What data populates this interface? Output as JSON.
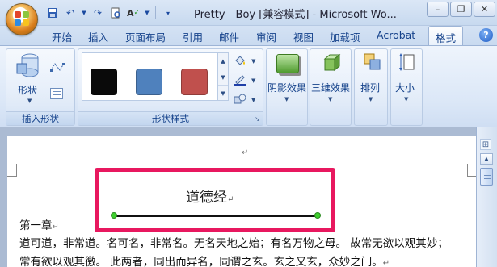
{
  "titlebar": {
    "title": "Pretty—Boy [兼容模式] - Microsoft Wo...",
    "qat_icons": [
      "save-icon",
      "undo-icon",
      "redo-icon",
      "print-preview-icon",
      "spelling-icon",
      "customize-icon"
    ]
  },
  "window_controls": {
    "minimize": "–",
    "restore": "❐",
    "close": "✕"
  },
  "tabs": [
    {
      "label": "开始"
    },
    {
      "label": "插入"
    },
    {
      "label": "页面布局"
    },
    {
      "label": "引用"
    },
    {
      "label": "邮件"
    },
    {
      "label": "审阅"
    },
    {
      "label": "视图"
    },
    {
      "label": "加载项"
    },
    {
      "label": "Acrobat"
    },
    {
      "label": "格式"
    }
  ],
  "ribbon": {
    "insert_shape": {
      "shape_btn": "形状",
      "group_label": "插入形状"
    },
    "shape_styles": {
      "group_label": "形状样式",
      "swatches": [
        "#0a0a0a",
        "#4f81bd",
        "#c0504d"
      ]
    },
    "buttons": {
      "shadow": "阴影效果",
      "threed": "三维效果",
      "arrange": "排列",
      "size": "大小"
    }
  },
  "document": {
    "heading": "道德经",
    "chapter": "第一章",
    "line1": "道可道，非常道。名可名，非常名。无名天地之始；有名万物之母。 故常无欲以观其妙；",
    "line2": "常有欲以观其徼。 此两者，同出而异名，同谓之玄。玄之又玄，众妙之门。",
    "para_mark": "↵"
  },
  "colors": {
    "highlight": "#e8185f",
    "handle": "#3fcf2f"
  }
}
